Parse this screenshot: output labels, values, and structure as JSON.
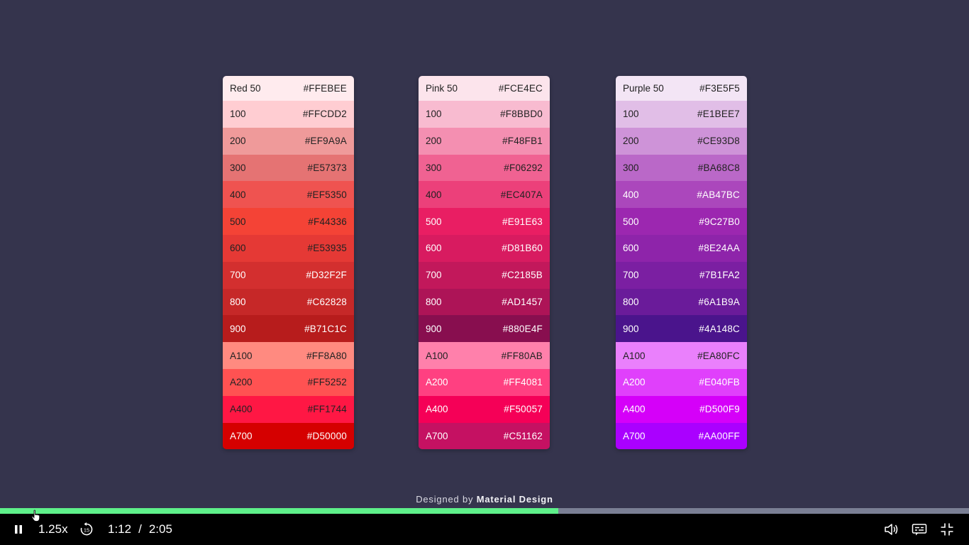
{
  "video": {
    "credit_prefix": "Designed by",
    "credit_brand": "Material Design",
    "palettes": [
      {
        "name": "red",
        "swatches": [
          {
            "label": "Red 50",
            "hex": "#FFEBEE",
            "text": "#222222"
          },
          {
            "label": "100",
            "hex": "#FFCDD2",
            "text": "#222222"
          },
          {
            "label": "200",
            "hex": "#EF9A9A",
            "text": "#222222"
          },
          {
            "label": "300",
            "hex": "#E57373",
            "text": "#222222"
          },
          {
            "label": "400",
            "hex": "#EF5350",
            "text": "#222222"
          },
          {
            "label": "500",
            "hex": "#F44336",
            "text": "#222222"
          },
          {
            "label": "600",
            "hex": "#E53935",
            "text": "#222222"
          },
          {
            "label": "700",
            "hex": "#D32F2F",
            "text": "#ffffff"
          },
          {
            "label": "800",
            "hex": "#C62828",
            "text": "#ffffff"
          },
          {
            "label": "900",
            "hex": "#B71C1C",
            "text": "#ffffff"
          },
          {
            "label": "A100",
            "hex": "#FF8A80",
            "text": "#222222"
          },
          {
            "label": "A200",
            "hex": "#FF5252",
            "text": "#222222"
          },
          {
            "label": "A400",
            "hex": "#FF1744",
            "text": "#222222"
          },
          {
            "label": "A700",
            "hex": "#D50000",
            "text": "#ffffff"
          }
        ]
      },
      {
        "name": "pink",
        "swatches": [
          {
            "label": "Pink 50",
            "hex": "#FCE4EC",
            "text": "#222222"
          },
          {
            "label": "100",
            "hex": "#F8BBD0",
            "text": "#222222"
          },
          {
            "label": "200",
            "hex": "#F48FB1",
            "text": "#222222"
          },
          {
            "label": "300",
            "hex": "#F06292",
            "text": "#222222"
          },
          {
            "label": "400",
            "hex": "#EC407A",
            "text": "#222222"
          },
          {
            "label": "500",
            "hex": "#E91E63",
            "text": "#ffffff"
          },
          {
            "label": "600",
            "hex": "#D81B60",
            "text": "#ffffff"
          },
          {
            "label": "700",
            "hex": "#C2185B",
            "text": "#ffffff"
          },
          {
            "label": "800",
            "hex": "#AD1457",
            "text": "#ffffff"
          },
          {
            "label": "900",
            "hex": "#880E4F",
            "text": "#ffffff"
          },
          {
            "label": "A100",
            "hex": "#FF80AB",
            "text": "#222222"
          },
          {
            "label": "A200",
            "hex": "#FF4081",
            "text": "#ffffff"
          },
          {
            "label": "A400",
            "hex": "#F50057",
            "text": "#ffffff"
          },
          {
            "label": "A700",
            "hex": "#C51162",
            "text": "#ffffff"
          }
        ]
      },
      {
        "name": "purple",
        "swatches": [
          {
            "label": "Purple 50",
            "hex": "#F3E5F5",
            "text": "#222222"
          },
          {
            "label": "100",
            "hex": "#E1BEE7",
            "text": "#222222"
          },
          {
            "label": "200",
            "hex": "#CE93D8",
            "text": "#222222"
          },
          {
            "label": "300",
            "hex": "#BA68C8",
            "text": "#222222"
          },
          {
            "label": "400",
            "hex": "#AB47BC",
            "text": "#ffffff"
          },
          {
            "label": "500",
            "hex": "#9C27B0",
            "text": "#ffffff"
          },
          {
            "label": "600",
            "hex": "#8E24AA",
            "text": "#ffffff"
          },
          {
            "label": "700",
            "hex": "#7B1FA2",
            "text": "#ffffff"
          },
          {
            "label": "800",
            "hex": "#6A1B9A",
            "text": "#ffffff"
          },
          {
            "label": "900",
            "hex": "#4A148C",
            "text": "#ffffff"
          },
          {
            "label": "A100",
            "hex": "#EA80FC",
            "text": "#222222"
          },
          {
            "label": "A200",
            "hex": "#E040FB",
            "text": "#ffffff"
          },
          {
            "label": "A400",
            "hex": "#D500F9",
            "text": "#ffffff"
          },
          {
            "label": "A700",
            "hex": "#AA00FF",
            "text": "#ffffff"
          }
        ]
      }
    ]
  },
  "player": {
    "speed": "1.25x",
    "current_time": "1:12",
    "separator": "/",
    "duration": "2:05",
    "progress_fraction": 0.576,
    "progress_color": "#5ef08a",
    "icons": {
      "play_pause": "pause-icon",
      "rewind": "rewind-15-icon",
      "volume": "volume-icon",
      "captions": "captions-icon",
      "fullscreen": "exit-fullscreen-icon"
    },
    "rewind_seconds": "15"
  }
}
